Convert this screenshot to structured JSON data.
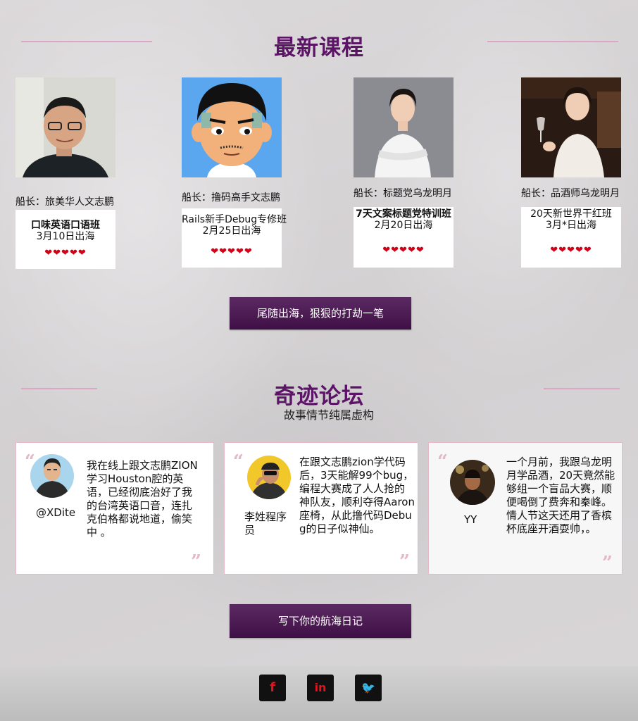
{
  "courses_section": {
    "title": "最新课程",
    "courses": [
      {
        "captain": "船长：旅美华人文志鹏",
        "title": "口味英语口语班",
        "date": "3月10日出海",
        "hearts": "❤❤❤❤❤"
      },
      {
        "captain": "船长：撸码高手文志鹏",
        "title": "Rails新手Debug专修班",
        "date": "2月25日出海",
        "hearts": "❤❤❤❤❤"
      },
      {
        "captain": "船长：标题党乌龙明月",
        "title": "7天文案标题党特训班",
        "date": "2月20日出海",
        "hearts": "❤❤❤❤❤"
      },
      {
        "captain": "船长：品酒师乌龙明月",
        "title": "20天新世界干红班",
        "date": "3月*日出海",
        "hearts": "❤❤❤❤❤"
      }
    ],
    "cta": "尾随出海，狠狠的打劫一笔"
  },
  "forum_section": {
    "title": "奇迹论坛",
    "subtitle": "故事情节纯属虚构",
    "testimonials": [
      {
        "name": "@XDite",
        "text": "我在线上跟文志鹏ZION学习Houston腔的英语，已经彻底治好了我的台湾英语口音，连扎克伯格都说地道，偷笑中 。"
      },
      {
        "name": "李姓程序员",
        "text": "在跟文志鹏zion学代码后，3天能解99个bug，编程大赛成了人人抢的神队友，顺利夺得Aaron座椅，从此撸代码Debug的日子似神仙。"
      },
      {
        "name": "YY",
        "text": "一个月前，我跟乌龙明月学品酒，20天竟然能够组一个盲品大赛，顺便喝倒了费奔和秦峰。情人节这天还用了香槟杯底座开酒耍帅，。"
      }
    ],
    "quote_open": "“",
    "quote_close": "”",
    "cta": "写下你的航海日记"
  },
  "footer": {
    "social": [
      {
        "icon": "facebook-icon",
        "glyph": "f"
      },
      {
        "icon": "linkedin-icon",
        "glyph": "in"
      },
      {
        "icon": "twitter-icon",
        "glyph": "🐦"
      }
    ]
  },
  "colors": {
    "accent": "#5c1467",
    "button": "#4a1a52",
    "heart": "#d40016",
    "divider": "#dca6c6",
    "social_icon": "#e3121b"
  }
}
